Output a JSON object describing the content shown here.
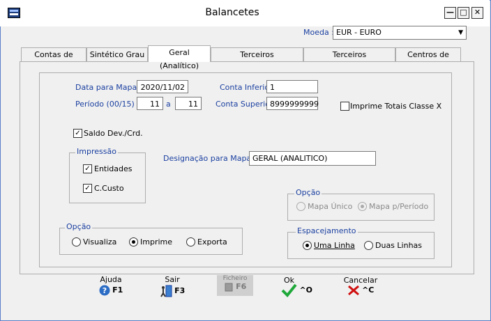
{
  "window": {
    "title": "Balancetes"
  },
  "moeda": {
    "label": "Moeda :",
    "value": "EUR - EURO"
  },
  "tabs": [
    {
      "label": "Contas de Razão"
    },
    {
      "label": "Sintético Grau X"
    },
    {
      "label": "Geral (Analítico)"
    },
    {
      "label": "Terceiros Conta/Entidade"
    },
    {
      "label": "Terceiros Entidade/Conta"
    },
    {
      "label": "Centros de Custo"
    }
  ],
  "form": {
    "data_mapa_label": "Data para Mapa",
    "data_mapa_value": "2020/11/02",
    "periodo_label": "Período (00/15)",
    "periodo_from": "11",
    "periodo_sep": "a",
    "periodo_to": "11",
    "conta_inferior_label": "Conta Inferior",
    "conta_inferior_value": "1",
    "conta_superior_label": "Conta Superior",
    "conta_superior_value": "8999999999",
    "imprime_totais_label": "Imprime Totais Classe X",
    "saldo_label": "Saldo Dev./Crd.",
    "impressao_title": "Impressão",
    "entidades_label": "Entidades",
    "ccusto_label": "C.Custo",
    "designacao_label": "Designação para Mapa",
    "designacao_value": "GERAL (ANALITICO)",
    "opcao_mapa_title": "Opção",
    "mapa_unico_label": "Mapa Único",
    "mapa_periodo_label": "Mapa p/Período",
    "opcao_saida_title": "Opção",
    "visualiza_label": "Visualiza",
    "imprime_label": "Imprime",
    "exporta_label": "Exporta",
    "espacamento_title": "Espacejamento",
    "uma_linha_label": "Uma Linha",
    "duas_linhas_label": "Duas Linhas"
  },
  "footer": {
    "ajuda_label": "Ajuda",
    "ajuda_key": "F1",
    "sair_label": "Sair",
    "sair_key": "F3",
    "ficheiro_label": "Ficheiro",
    "ficheiro_key": "F6",
    "ok_label": "Ok",
    "ok_key": "^O",
    "cancelar_label": "Cancelar",
    "cancelar_key": "^C"
  },
  "colors": {
    "label_blue": "#1a3fa0",
    "ok_green": "#1fa83a",
    "cancel_red": "#d01010",
    "help_blue": "#2b6cc4"
  }
}
